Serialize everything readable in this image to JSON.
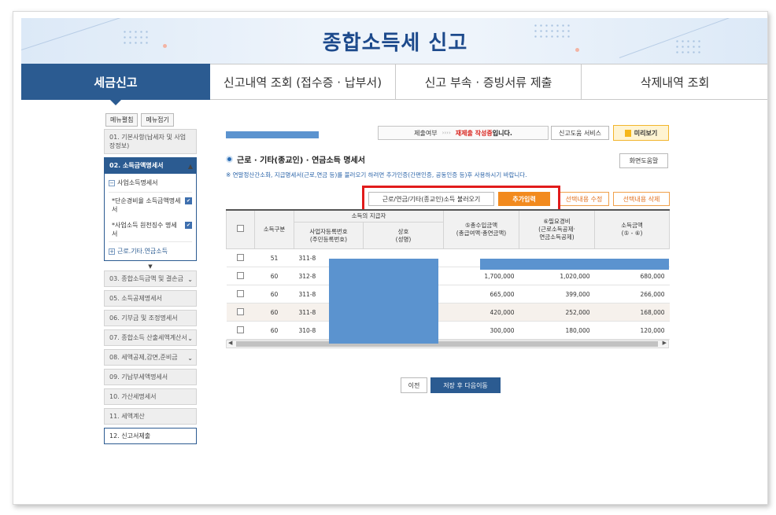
{
  "banner": {
    "title": "종합소득세 신고"
  },
  "tabs": [
    {
      "label": "세금신고"
    },
    {
      "label": "신고내역 조회 (접수증 · 납부서)"
    },
    {
      "label": "신고 부속 · 증빙서류 제출"
    },
    {
      "label": "삭제내역 조회"
    }
  ],
  "sidebar": {
    "expand_all": "메뉴펼침",
    "collapse_all": "메뉴접기",
    "item01": "01. 기본사항(납세자 및 사업장정보)",
    "item02": "02. 소득금액명세서",
    "sub_head": "사업소득명세서",
    "sub1": "*단순경비율 소득금액명세서",
    "sub2": "*사업소득 원천징수 명세서",
    "sub_link": "근로.기타.연금소득",
    "item03": "03. 종합소득금액 및 결손금",
    "item05": "05. 소득공제명세서",
    "item06": "06. 기부금 및 조정명세서",
    "item07": "07. 종합소득 산출세액계산서",
    "item08": "08. 세액공제,감면,준비금",
    "item09": "09. 기납부세액명세서",
    "item10": "10. 가산세명세서",
    "item11": "11. 세액계산",
    "item12": "12. 신고서제출"
  },
  "status": {
    "submit_label": "제출여부",
    "arrows": "››››",
    "state": "재제출 작성중",
    "suffix": "입니다.",
    "service_btn": "신고도움 서비스",
    "preview_btn": "미리보기"
  },
  "section": {
    "title": "근로 · 기타(종교인) · 연금소득 명세서",
    "help_btn": "화면도움말",
    "notice": "※ 연말정산간소화, 지급명세서(근로,연금 등)를 불러오기 하려면 추가인증(간편인증, 공동인증 등)후 사용하시기 바랍니다."
  },
  "actions": {
    "load": "근로/연금/기타(종교인)소득 불러오기",
    "add": "추가입력",
    "edit": "선택내용 수정",
    "delete": "선택내용 삭제"
  },
  "table": {
    "col_type": "소득구분",
    "col_payer_group": "소득의 지급자",
    "col_reg_no": "사업자등록번호\n(주민등록번호)",
    "col_name": "상호\n(성명)",
    "col_revenue": "⑤총수입금액\n(총급여액·총연금액)",
    "col_expense": "⑥필요경비\n(근로소득공제·\n연금소득공제)",
    "col_income": "소득금액\n(⑤ - ⑥)",
    "rows": [
      {
        "type": "51",
        "reg": "311-8",
        "name": "",
        "revenue": "",
        "expense": "",
        "income": ""
      },
      {
        "type": "60",
        "reg": "312-8",
        "name": "",
        "revenue": "1,700,000",
        "expense": "1,020,000",
        "income": "680,000"
      },
      {
        "type": "60",
        "reg": "311-8",
        "name": "",
        "revenue": "665,000",
        "expense": "399,000",
        "income": "266,000"
      },
      {
        "type": "60",
        "reg": "311-8",
        "name": "",
        "revenue": "420,000",
        "expense": "252,000",
        "income": "168,000"
      },
      {
        "type": "60",
        "reg": "310-8",
        "name": "",
        "revenue": "300,000",
        "expense": "180,000",
        "income": "120,000"
      }
    ]
  },
  "nav": {
    "prev": "이전",
    "next": "저장 후 다음이동"
  },
  "colors": {
    "primary": "#2b5b91",
    "accent": "#f28a1e",
    "highlight": "#e11b1b",
    "mask": "#5b93cf"
  }
}
